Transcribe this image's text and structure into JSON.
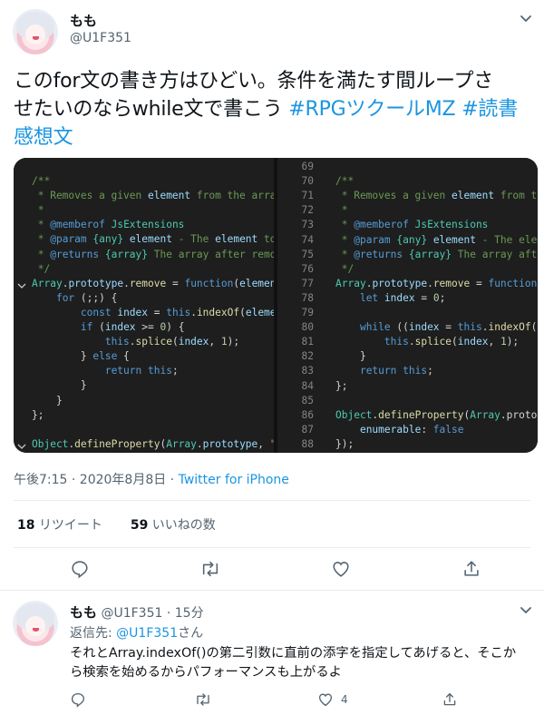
{
  "tweet": {
    "display_name": "もも",
    "handle": "@U1F351",
    "text_plain": "この for 文の書き方はひどい。条件を満たす間ループさせたいのならwhile文で書こう ",
    "text_line1": "このfor文の書き方はひどい。条件を満たす間ループさ",
    "text_line2_plain": "せたいのならwhile文で書こう ",
    "hashtag1": "#RPGツクールMZ",
    "hashtag2_part1": "#読書",
    "hashtag2_part2": "感想文",
    "timestamp": "午後7:15 · 2020年8月8日",
    "source": "Twitter for iPhone",
    "retweets_count": "18",
    "retweets_label": "リツイート",
    "likes_count": "59",
    "likes_label": "いいねの数"
  },
  "code_left": {
    "lines": [
      "/**",
      " * Removes a given element from the array",
      " *",
      " * @memberof JsExtensions",
      " * @param {any} element - The element to r",
      " * @returns {array} The array after remove",
      " */",
      "Array.prototype.remove = function(element)",
      "    for (;;) {",
      "        const index = this.indexOf(element",
      "        if (index >= 0) {",
      "            this.splice(index, 1);",
      "        } else {",
      "            return this;",
      "        }",
      "    }",
      "};",
      "",
      "Object.defineProperty(Array.prototype, \"re"
    ]
  },
  "code_right": {
    "line_numbers": [
      "69",
      "70",
      "71",
      "72",
      "73",
      "74",
      "75",
      "76",
      "77",
      "78",
      "79",
      "80",
      "81",
      "82",
      "83",
      "84",
      "85",
      "86",
      "87",
      "88"
    ],
    "lines": [
      "",
      "/**",
      " * Removes a given element from the",
      " *",
      " * @memberof JsExtensions",
      " * @param {any} element - The eleme",
      " * @returns {array} The array after",
      " */",
      "Array.prototype.remove = function(e",
      "    let index = 0;",
      "",
      "    while ((index = this.indexOf(el",
      "        this.splice(index, 1);",
      "    }",
      "    return this;",
      "};",
      "",
      "Object.defineProperty(Array.protot",
      "    enumerable: false",
      "});"
    ]
  },
  "reply": {
    "display_name": "もも",
    "handle": "@U1F351",
    "time": "· 15分",
    "replying_to_label": "返信先:",
    "replying_to_handle": "@U1F351",
    "replying_to_suffix": "さん",
    "text_line1": "それとArray.indexOf()の第二引数に直前の添字を指定してあげると、そこか",
    "text_line2": "ら検索を始めるからパフォーマンスも上がるよ",
    "like_count": "4"
  },
  "colors": {
    "link": "#1b95e0",
    "text": "#0f1419",
    "muted": "#536471",
    "code_bg": "#1e1e1e"
  },
  "icons": [
    "chevron-down-icon",
    "reply-icon",
    "retweet-icon",
    "like-icon",
    "share-icon"
  ]
}
